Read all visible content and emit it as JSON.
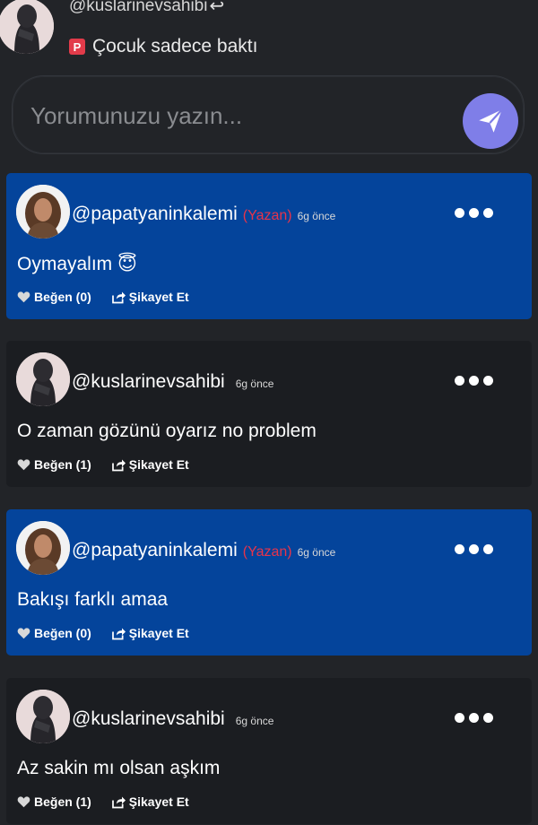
{
  "top_reply": {
    "username": "@kuslarinevsahibi",
    "reply_icon": "reply-arrow-icon",
    "badge_letter": "P",
    "text": "Çocuk sadece baktı"
  },
  "comment_input": {
    "placeholder": "Yorumunuzu yazın...",
    "send_icon": "paper-plane-icon",
    "accent": "#7f7ee8"
  },
  "comments": [
    {
      "username": "@papatyaninkalemi",
      "author_tag": "(Yazan)",
      "time": "6g önce",
      "text": "Oymayalım 😇",
      "like_label": "Beğen (0)",
      "report_label": "Şikayet Et",
      "is_author": true
    },
    {
      "username": "@kuslarinevsahibi",
      "author_tag": "",
      "time": "6g önce",
      "text": "O zaman gözünü oyarız no problem",
      "like_label": "Beğen (1)",
      "report_label": "Şikayet Et",
      "is_author": false
    },
    {
      "username": "@papatyaninkalemi",
      "author_tag": "(Yazan)",
      "time": "6g önce",
      "text": "Bakışı farklı amaa",
      "like_label": "Beğen (0)",
      "report_label": "Şikayet Et",
      "is_author": true
    },
    {
      "username": "@kuslarinevsahibi",
      "author_tag": "",
      "time": "6g önce",
      "text": "Az sakin mı olsan aşkım",
      "like_label": "Beğen (1)",
      "report_label": "Şikayet Et",
      "is_author": false
    }
  ],
  "colors": {
    "background": "#222428",
    "author_card": "#04449b",
    "reader_card": "#1b1d21",
    "author_tag": "#e8344a"
  }
}
